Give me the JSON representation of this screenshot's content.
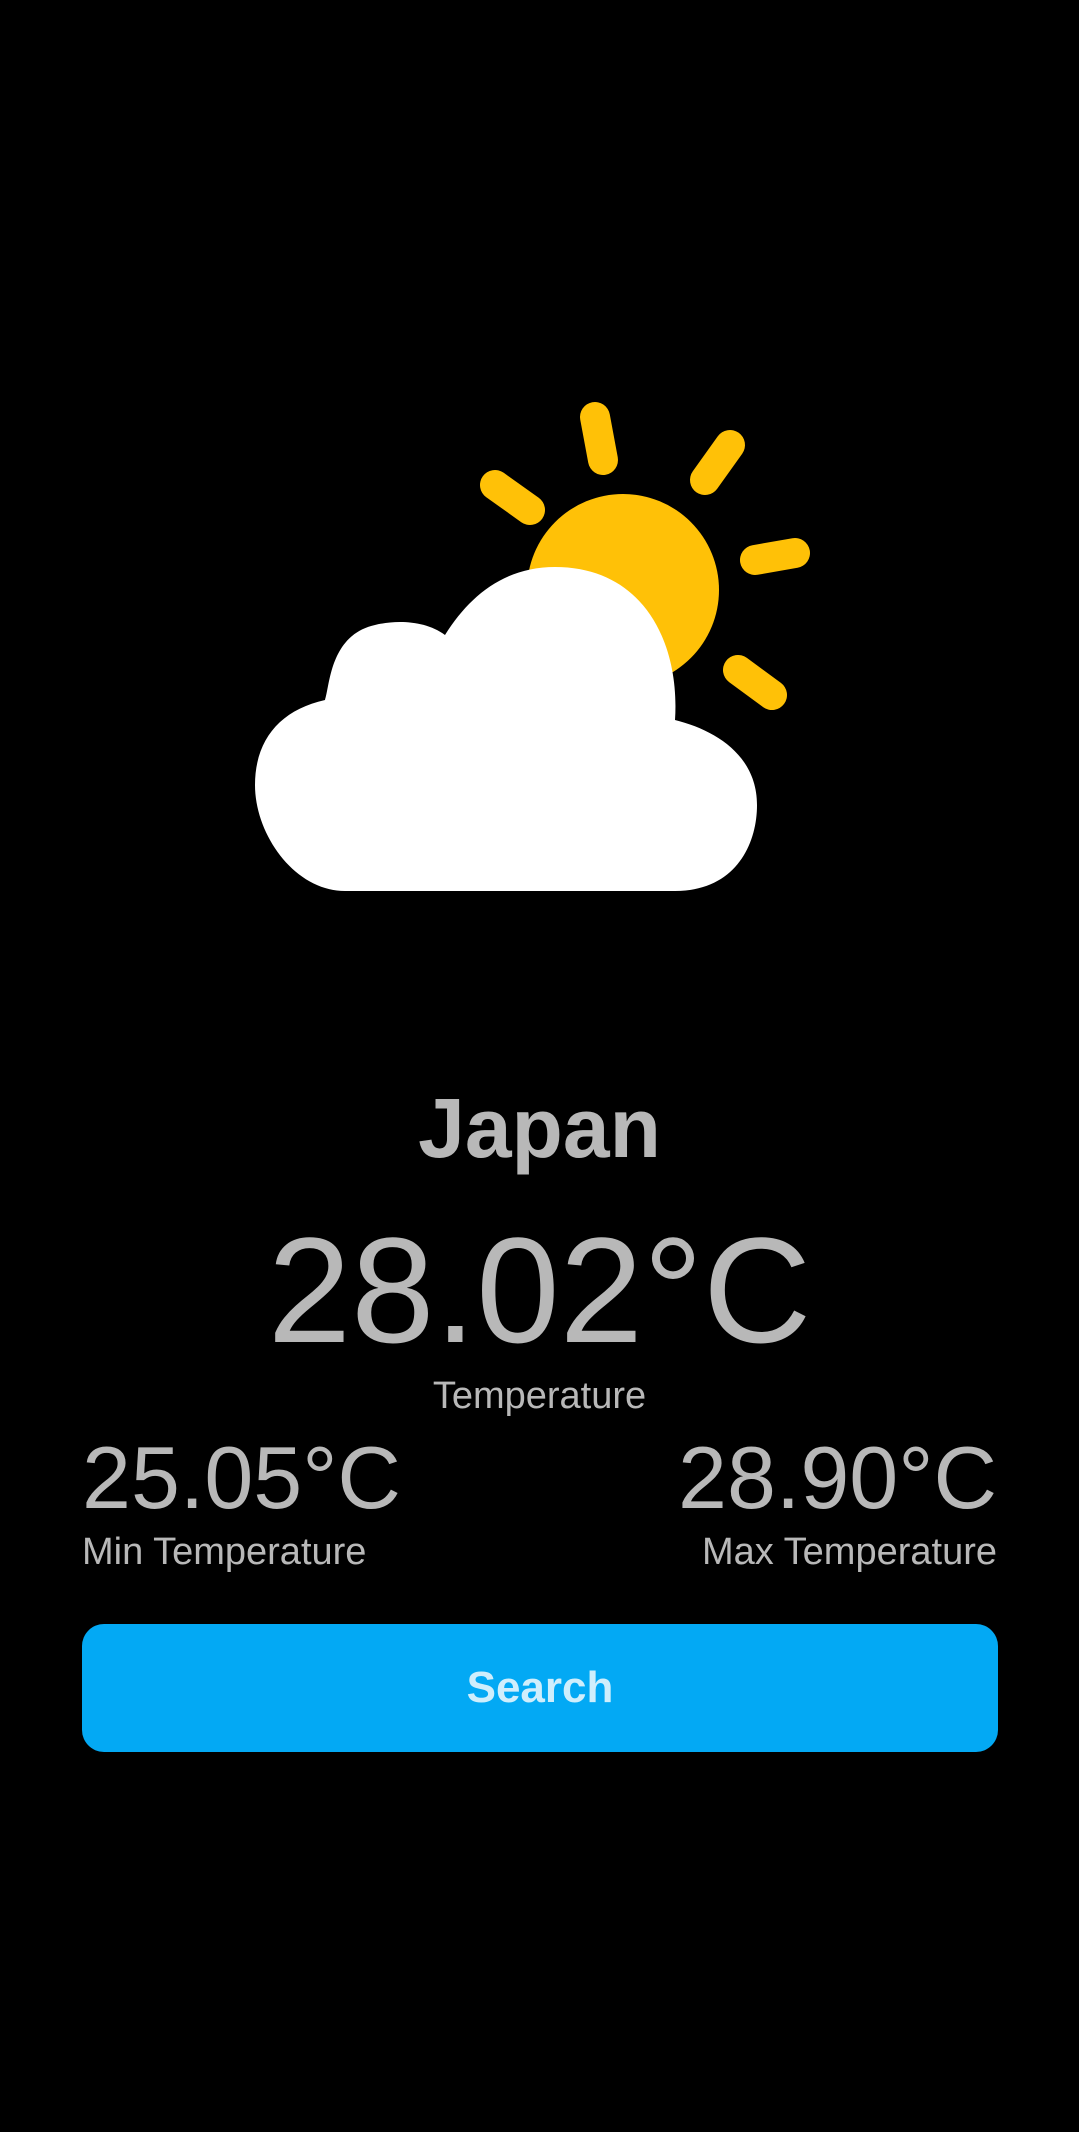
{
  "weather": {
    "icon": "partly-cloudy-icon",
    "city": "Japan",
    "temperature": "28.02°C",
    "temperature_label": "Temperature",
    "min_temperature": "25.05°C",
    "min_label": "Min Temperature",
    "max_temperature": "28.90°C",
    "max_label": "Max Temperature"
  },
  "actions": {
    "search_label": "Search"
  },
  "colors": {
    "background": "#000000",
    "text": "#b8b8b8",
    "sun": "#ffc107",
    "cloud": "#ffffff",
    "button": "#03a9f4",
    "button_text": "#cfeefc"
  }
}
